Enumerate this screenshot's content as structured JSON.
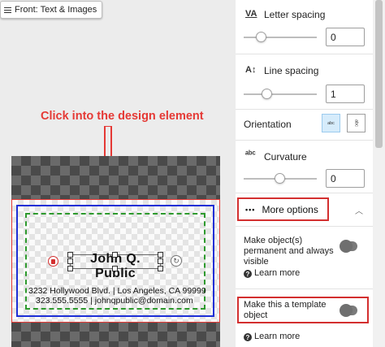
{
  "canvas": {
    "tab_label": "Front: Text & Images",
    "annotation": "Click into the design element",
    "card": {
      "name": "John Q. Public",
      "address": "3232 Hollywood Blvd. | Los Angeles, CA 99999",
      "contact": "323.555.5555 | johnqpublic@domain.com"
    }
  },
  "panel": {
    "letter_spacing": {
      "icon": "VA",
      "label": "Letter spacing",
      "value": "0"
    },
    "line_spacing": {
      "icon": "A↕",
      "label": "Line spacing",
      "value": "1"
    },
    "orientation": {
      "label": "Orientation",
      "option_horizontal": "abc",
      "option_vertical": "abc"
    },
    "curvature": {
      "icon": "ᵃᵇᶜ",
      "label": "Curvature",
      "value": "0"
    },
    "more_options": {
      "dots": "•••",
      "label": "More options"
    },
    "permanent": {
      "label": "Make object(s) permanent and always visible",
      "learn_more": "Learn more"
    },
    "template": {
      "label": "Make this a template object",
      "learn_more": "Learn more"
    }
  },
  "colors": {
    "annotation_red": "#e53935",
    "trim_blue": "#1e2fd6",
    "safe_green": "#2e9a2e",
    "highlight_red": "#d32f2f"
  }
}
